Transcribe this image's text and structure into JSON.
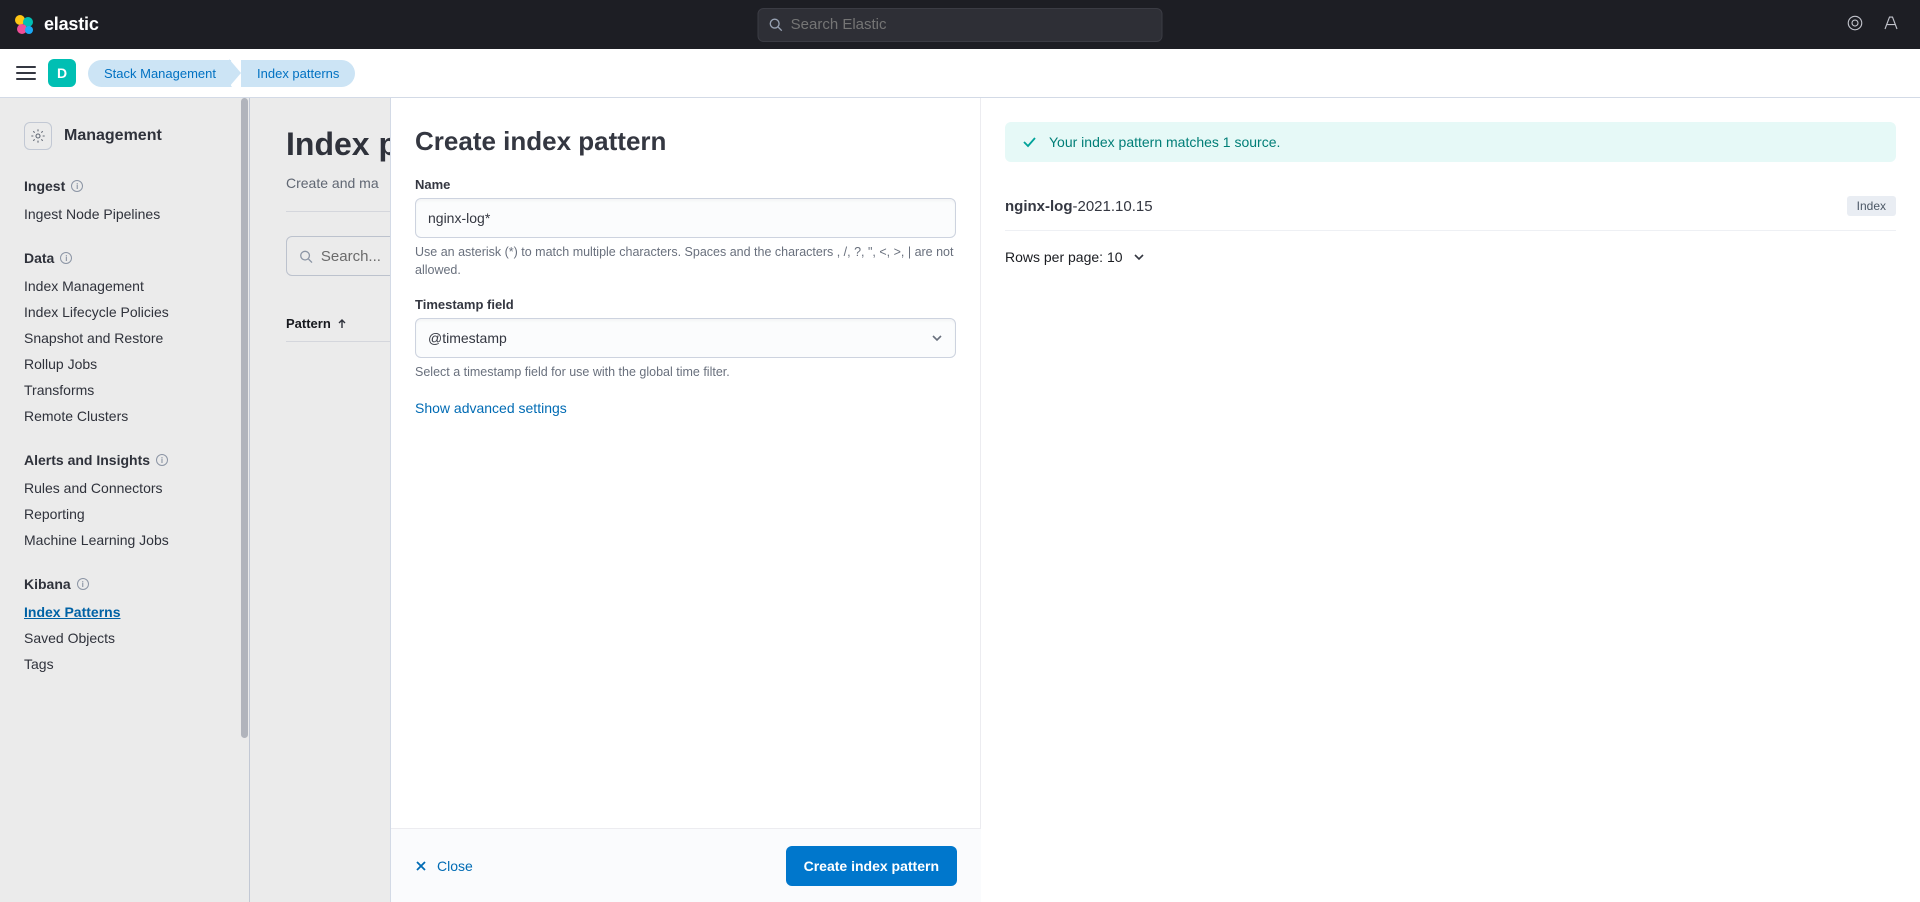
{
  "topbar": {
    "brand": "elastic",
    "search_placeholder": "Search Elastic"
  },
  "subnav": {
    "space_letter": "D",
    "breadcrumbs": [
      "Stack Management",
      "Index patterns"
    ]
  },
  "sidebar": {
    "title": "Management",
    "sections": [
      {
        "title": "Ingest",
        "items": [
          "Ingest Node Pipelines"
        ]
      },
      {
        "title": "Data",
        "items": [
          "Index Management",
          "Index Lifecycle Policies",
          "Snapshot and Restore",
          "Rollup Jobs",
          "Transforms",
          "Remote Clusters"
        ]
      },
      {
        "title": "Alerts and Insights",
        "items": [
          "Rules and Connectors",
          "Reporting",
          "Machine Learning Jobs"
        ]
      },
      {
        "title": "Kibana",
        "items": [
          "Index Patterns",
          "Saved Objects",
          "Tags"
        ]
      }
    ],
    "active": "Index Patterns"
  },
  "main": {
    "heading": "Index p",
    "subtitle": "Create and ma",
    "search_placeholder": "Search...",
    "table_col": "Pattern"
  },
  "flyout": {
    "title": "Create index pattern",
    "name_label": "Name",
    "name_value": "nginx-log*",
    "name_help": "Use an asterisk (*) to match multiple characters. Spaces and the characters , /, ?, \", <, >, | are not allowed.",
    "ts_label": "Timestamp field",
    "ts_value": "@timestamp",
    "ts_help": "Select a timestamp field for use with the global time filter.",
    "adv_link": "Show advanced settings",
    "close_label": "Close",
    "submit_label": "Create index pattern"
  },
  "right": {
    "callout": "Your index pattern matches 1 source.",
    "match_bold": "nginx-log",
    "match_rest": "-2021.10.15",
    "badge": "Index",
    "rows": "Rows per page: 10"
  }
}
